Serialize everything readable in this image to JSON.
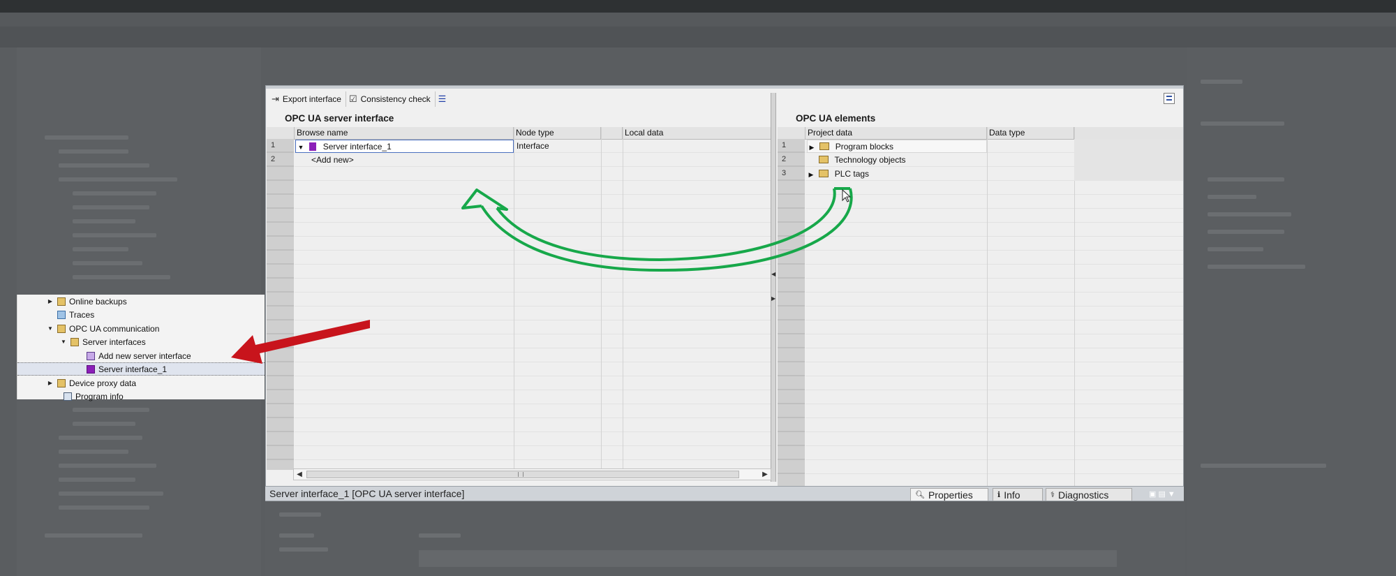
{
  "toolbar": {
    "export_label": "Export interface",
    "consistency_label": "Consistency check"
  },
  "left_pane": {
    "title": "OPC UA server interface",
    "columns": [
      "Browse name",
      "Node type",
      "Local data"
    ],
    "row_numbers": [
      "1",
      "2"
    ],
    "rows": [
      {
        "browse_name": "Server interface_1",
        "node_type": "Interface",
        "local_data": ""
      },
      {
        "browse_name": "<Add new>",
        "node_type": "",
        "local_data": ""
      }
    ]
  },
  "right_pane": {
    "title": "OPC UA elements",
    "columns": [
      "Project data",
      "Data type"
    ],
    "row_numbers": [
      "1",
      "2",
      "3"
    ],
    "rows": [
      {
        "project_data": "Program blocks",
        "data_type": ""
      },
      {
        "project_data": "Technology objects",
        "data_type": ""
      },
      {
        "project_data": "PLC tags",
        "data_type": ""
      }
    ]
  },
  "project_tree": {
    "items": [
      {
        "label": "Online backups",
        "expanded": false
      },
      {
        "label": "Traces",
        "expanded": null
      },
      {
        "label": "OPC UA communication",
        "expanded": true
      },
      {
        "label": "Server interfaces",
        "expanded": true
      },
      {
        "label": "Add new server interface",
        "expanded": null
      },
      {
        "label": "Server interface_1",
        "expanded": null,
        "selected": true
      },
      {
        "label": "Device proxy data",
        "expanded": false
      },
      {
        "label": "Program info",
        "expanded": null
      }
    ]
  },
  "status_bar": {
    "text": "Server interface_1 [OPC UA server interface]",
    "tabs": [
      "Properties",
      "Info",
      "Diagnostics"
    ]
  },
  "colors": {
    "annotation_red": "#c8141c",
    "annotation_green": "#17a84a",
    "interface_icon": "#8b1fb8"
  }
}
